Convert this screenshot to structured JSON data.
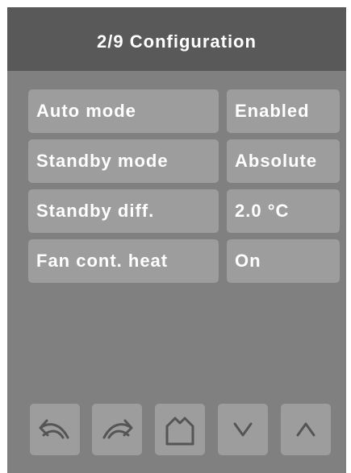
{
  "header": {
    "title": "2/9 Configuration"
  },
  "settings": [
    {
      "label": "Auto mode",
      "value": "Enabled"
    },
    {
      "label": "Standby mode",
      "value": "Absolute"
    },
    {
      "label": "Standby diff.",
      "value": "2.0 °C"
    },
    {
      "label": "Fan cont. heat",
      "value": "On"
    }
  ],
  "toolbar": {
    "buttons": [
      {
        "name": "undo-button",
        "icon": "undo-icon"
      },
      {
        "name": "redo-button",
        "icon": "redo-icon"
      },
      {
        "name": "home-button",
        "icon": "home-icon"
      },
      {
        "name": "down-button",
        "icon": "chevron-down-icon"
      },
      {
        "name": "up-button",
        "icon": "chevron-up-icon"
      }
    ]
  },
  "colors": {
    "header_bg": "#595959",
    "panel_bg": "#808080",
    "button_bg": "#9d9d9d",
    "text": "#ffffff",
    "icon": "#555555"
  }
}
